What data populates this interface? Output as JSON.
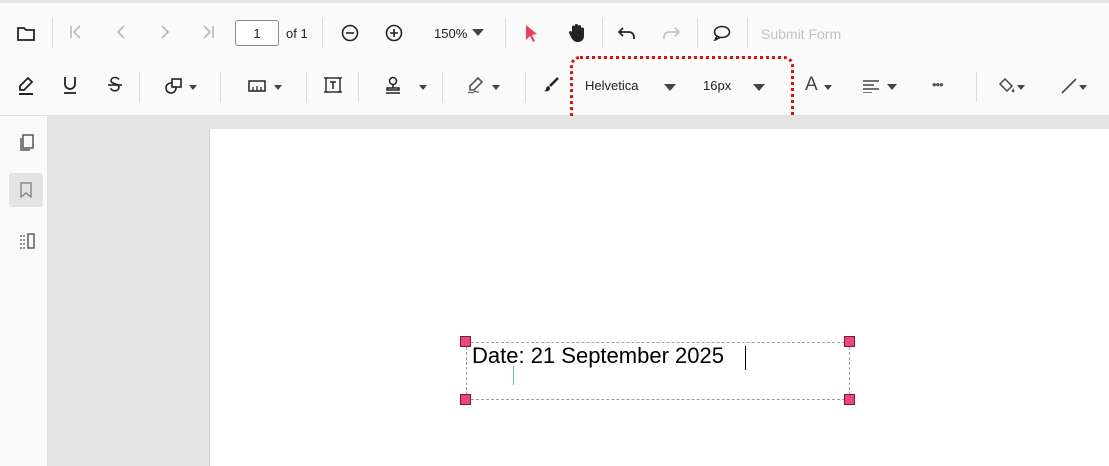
{
  "toolbar": {
    "page_number": "1",
    "page_of": "of 1",
    "zoom": "150%",
    "submit_form": "Submit Form"
  },
  "format": {
    "font_family": "Helvetica",
    "font_size": "16px",
    "font_color_glyph": "A",
    "more_glyph": "•••"
  },
  "document": {
    "free_text": "Date: 21 September 2025"
  },
  "colors": {
    "accent": "#e8435d",
    "highlight_box": "#d21414",
    "handle": "#f0457a"
  }
}
